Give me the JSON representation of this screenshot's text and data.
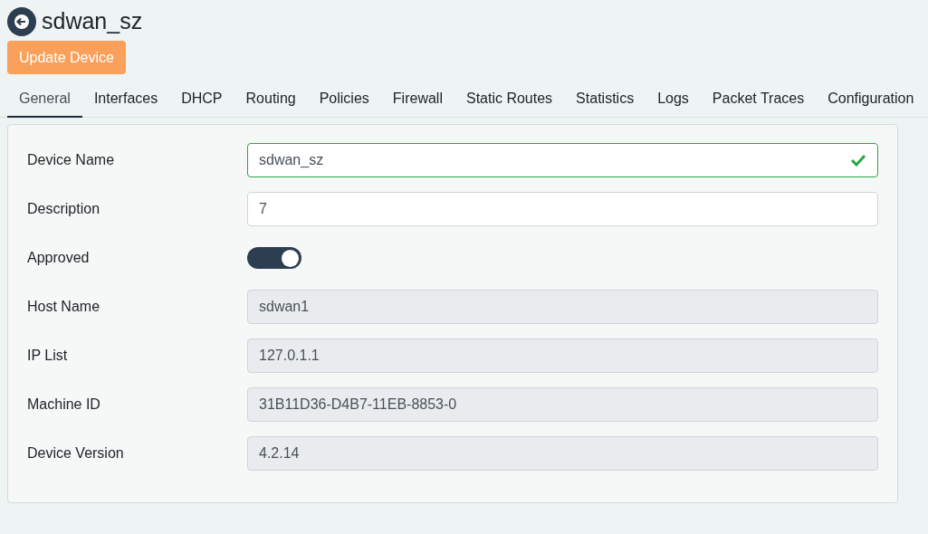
{
  "header": {
    "title": "sdwan_sz"
  },
  "update_button": "Update Device",
  "tabs": [
    {
      "label": "General",
      "selected": true
    },
    {
      "label": "Interfaces",
      "selected": false
    },
    {
      "label": "DHCP",
      "selected": false
    },
    {
      "label": "Routing",
      "selected": false
    },
    {
      "label": "Policies",
      "selected": false
    },
    {
      "label": "Firewall",
      "selected": false
    },
    {
      "label": "Static Routes",
      "selected": false
    },
    {
      "label": "Statistics",
      "selected": false
    },
    {
      "label": "Logs",
      "selected": false
    },
    {
      "label": "Packet Traces",
      "selected": false
    },
    {
      "label": "Configuration",
      "selected": false
    }
  ],
  "fields": [
    {
      "kind": "text",
      "label": "Device Name",
      "value": "sdwan_sz",
      "valid": true
    },
    {
      "kind": "text",
      "label": "Description",
      "value": "7",
      "valid": false
    },
    {
      "kind": "toggle",
      "label": "Approved",
      "on": true
    },
    {
      "kind": "readonly",
      "label": "Host Name",
      "value": "sdwan1"
    },
    {
      "kind": "readonly",
      "label": "IP List",
      "value": "127.0.1.1"
    },
    {
      "kind": "readonly",
      "label": "Machine ID",
      "value": "31B11D36-D4B7-11EB-8853-0"
    },
    {
      "kind": "readonly",
      "label": "Device Version",
      "value": "4.2.14"
    }
  ]
}
